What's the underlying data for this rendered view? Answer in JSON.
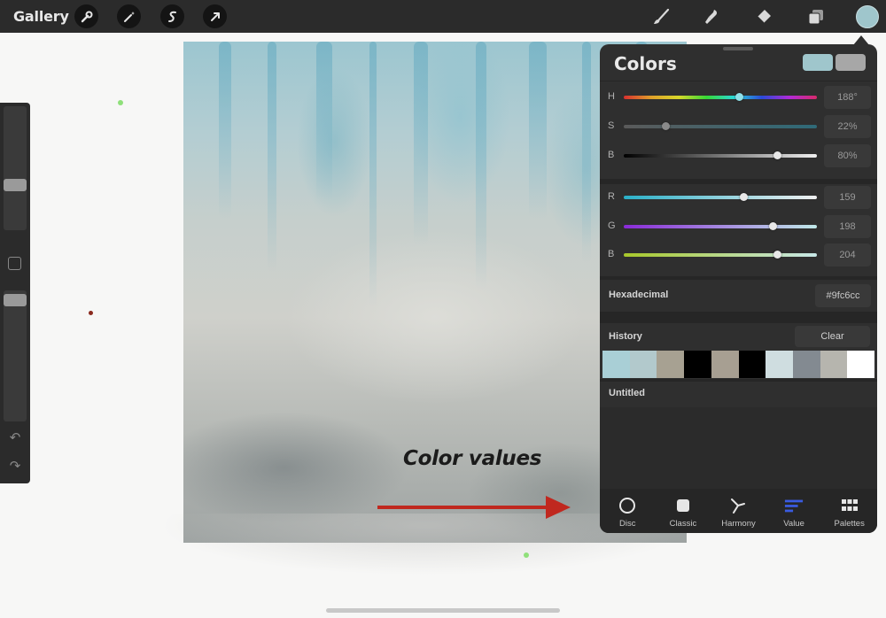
{
  "topbar": {
    "gallery_label": "Gallery",
    "left_tools": [
      "actions-icon",
      "adjustments-icon",
      "selection-icon",
      "transform-icon"
    ],
    "right_tools": [
      "brush-icon",
      "smudge-icon",
      "eraser-icon",
      "layers-icon",
      "color-swatch"
    ],
    "current_color": "#9fc6cc"
  },
  "annotation": {
    "text": "Color values",
    "arrow_color": "#c0281f"
  },
  "colors_panel": {
    "title": "Colors",
    "current_color": "#9fc6cc",
    "previous_color": "#a7a7a7",
    "hsb": [
      {
        "label": "H",
        "value": "188°",
        "level": 0.6
      },
      {
        "label": "S",
        "value": "22%",
        "level": 0.22
      },
      {
        "label": "B",
        "value": "80%",
        "level": 0.8
      }
    ],
    "rgb": [
      {
        "label": "R",
        "value": "159",
        "level": 0.62
      },
      {
        "label": "G",
        "value": "198",
        "level": 0.78
      },
      {
        "label": "B",
        "value": "204",
        "level": 0.8
      }
    ],
    "hex_label": "Hexadecimal",
    "hex_value": "#9fc6cc",
    "history_label": "History",
    "clear_label": "Clear",
    "history_colors": [
      "#a9cfd6",
      "#b2c9cc",
      "#a7a192",
      "#000000",
      "#a79f92",
      "#000000",
      "#cfdde0",
      "#838a91",
      "#b6b5ae",
      "#ffffff"
    ],
    "palette_name": "Untitled",
    "tabs": [
      {
        "label": "Disc",
        "icon": "disc-icon"
      },
      {
        "label": "Classic",
        "icon": "classic-icon"
      },
      {
        "label": "Harmony",
        "icon": "harmony-icon"
      },
      {
        "label": "Value",
        "icon": "value-icon",
        "active": true
      },
      {
        "label": "Palettes",
        "icon": "palettes-icon"
      }
    ]
  }
}
